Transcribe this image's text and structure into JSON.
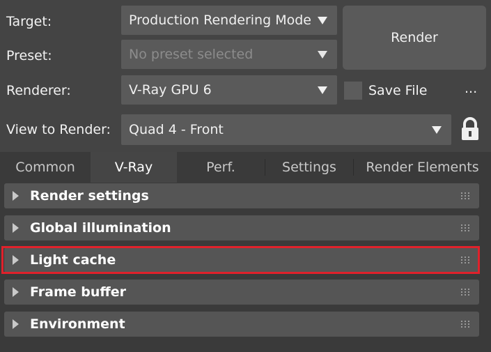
{
  "form": {
    "target_label": "Target:",
    "target_value": "Production Rendering Mode",
    "preset_label": "Preset:",
    "preset_value": "No preset selected",
    "renderer_label": "Renderer:",
    "renderer_value": "V-Ray GPU 6",
    "view_label": "View to Render:",
    "view_value": "Quad 4 - Front"
  },
  "actions": {
    "render_label": "Render",
    "save_file_label": "Save File",
    "more_label": "..."
  },
  "icons": {
    "lock": "lock-icon",
    "dropdown": "triangle-down-icon",
    "expand": "triangle-right-icon",
    "grip": "grip-dots-icon"
  },
  "tabs": [
    {
      "label": "Common"
    },
    {
      "label": "V-Ray"
    },
    {
      "label": "Perf."
    },
    {
      "label": "Settings"
    },
    {
      "label": "Render Elements"
    }
  ],
  "active_tab": "V-Ray",
  "rollouts": [
    {
      "title": "Render settings"
    },
    {
      "title": "Global illumination"
    },
    {
      "title": "Light cache"
    },
    {
      "title": "Frame buffer"
    },
    {
      "title": "Environment"
    }
  ],
  "colors": {
    "background": "#444444",
    "control": "#5a5a5a",
    "highlight": "#e0212b"
  }
}
